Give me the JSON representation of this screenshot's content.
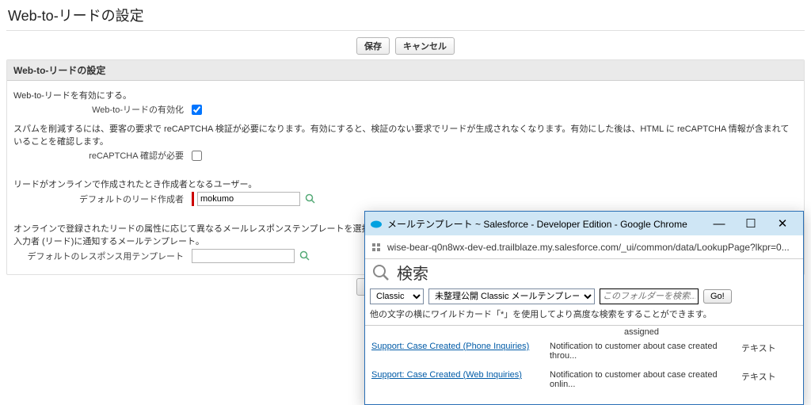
{
  "page": {
    "title": "Web-to-リードの設定"
  },
  "buttons": {
    "save": "保存",
    "cancel": "キャンセル"
  },
  "panel": {
    "header": "Web-to-リードの設定",
    "enable_desc": "Web-to-リードを有効にする。",
    "enable_label": "Web-to-リードの有効化",
    "recaptcha_desc": "スパムを削減するには、要客の要求で reCAPTCHA 検証が必要になります。有効にすると、検証のない要求でリードが生成されなくなります。有効にした後は、HTML に reCAPTCHA 情報が含まれていることを確認します。",
    "recaptcha_label": "reCAPTCHA 確認が必要",
    "creator_desc": "リードがオンラインで作成されたとき作成者となるユーザー。",
    "creator_label": "デフォルトのリード作成者",
    "creator_value": "mokumo",
    "template_desc": "オンラインで登録されたリードの属性に応じて異なるメールレスポンステンプレートを選択するには、リードの自動レスポンスルールを使用してください。Web-to-リードでリードが作成されたときに入力者 (リード)に通知するメールテンプレート。",
    "template_label": "デフォルトのレスポンス用テンプレート",
    "template_value": ""
  },
  "popup": {
    "title": "メールテンプレート ~ Salesforce - Developer Edition - Google Chrome",
    "url": "wise-bear-q0n8wx-dev-ed.trailblaze.my.salesforce.com/_ui/common/data/LookupPage?lkpr=0...",
    "search_title": "検索",
    "select1_value": "Classic",
    "select2_value": "未整理公開 Classic メールテンプレート",
    "search_placeholder": "このフォルダーを検索...",
    "go": "Go!",
    "hint": "他の文字の横にワイルドカード「*」を使用してより高度な検索をすることができます。",
    "truncated": "assigned",
    "rows": [
      {
        "name": "Support: Case Created (Phone Inquiries)",
        "desc": "Notification to customer about case created throu...",
        "type": "テキスト"
      },
      {
        "name": "Support: Case Created (Web Inquiries)",
        "desc": "Notification to customer about case created onlin...",
        "type": "テキスト"
      }
    ]
  }
}
